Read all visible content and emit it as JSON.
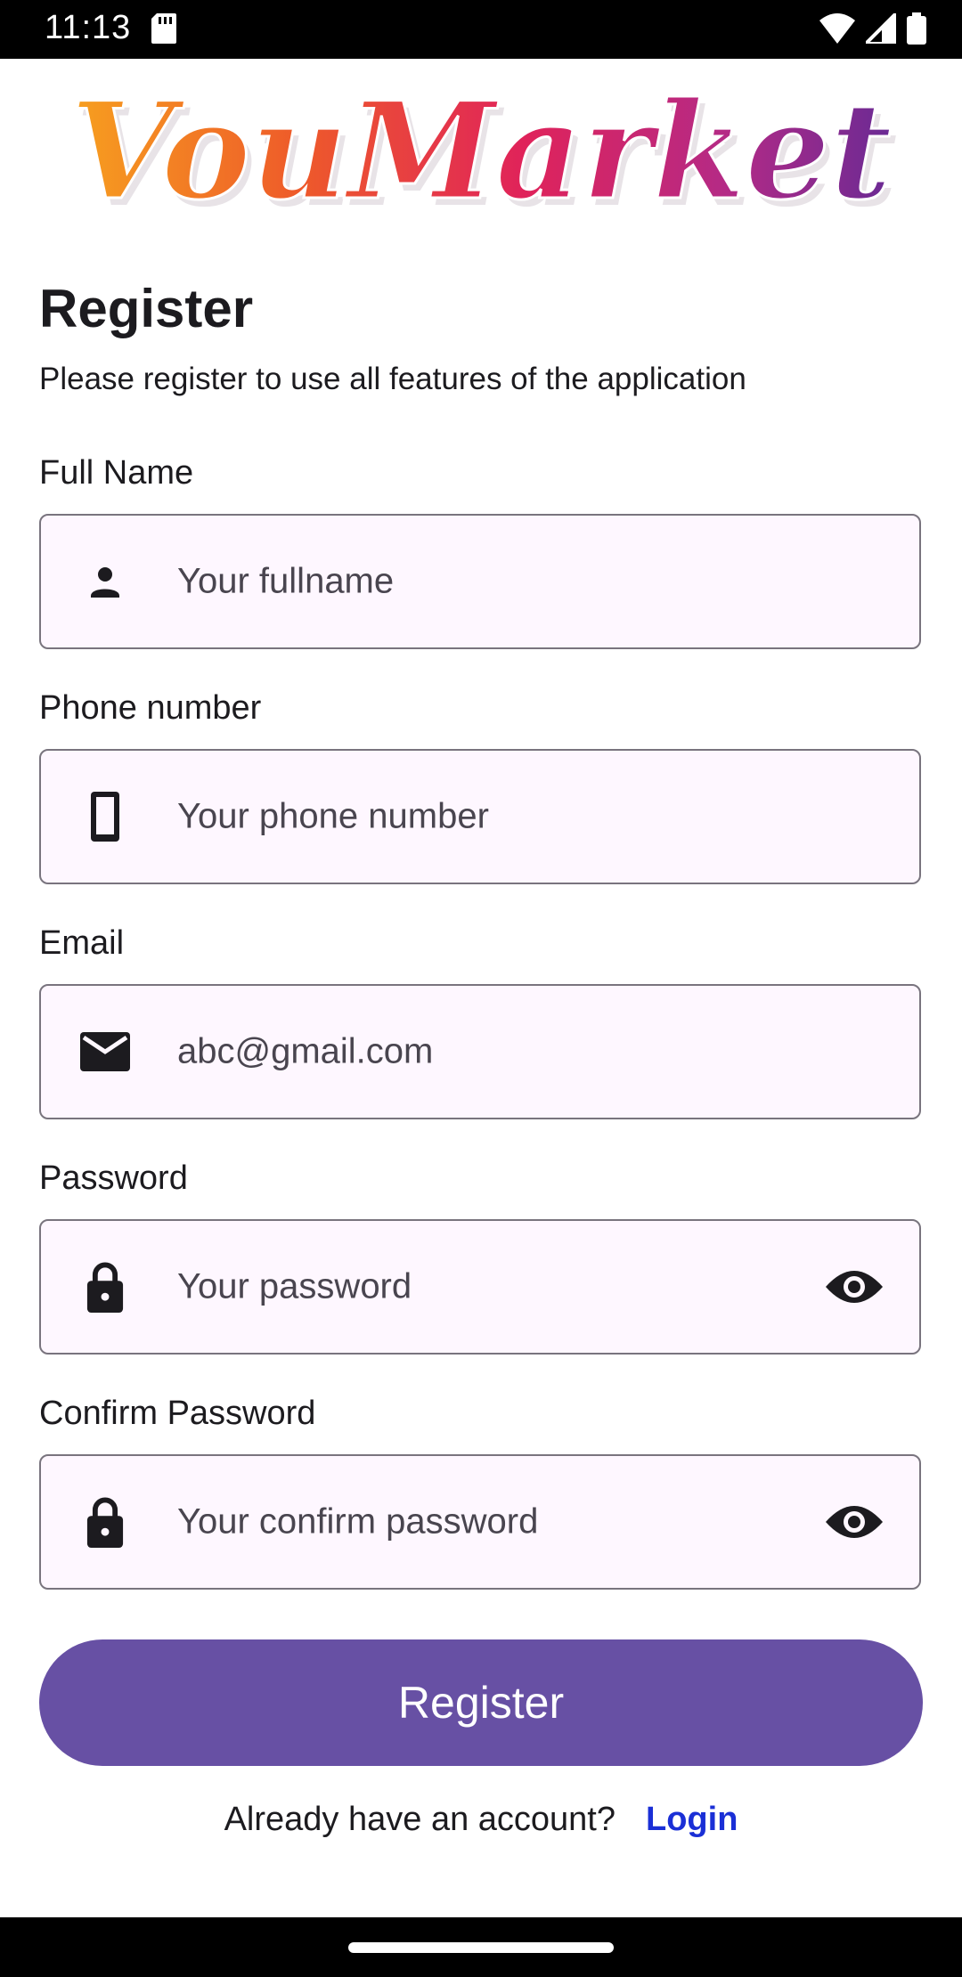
{
  "status_bar": {
    "time": "11:13",
    "icons": [
      "sd-card-icon",
      "wifi-icon",
      "signal-icon",
      "battery-icon"
    ]
  },
  "logo": {
    "text": "VouMarket"
  },
  "header": {
    "title": "Register",
    "subtitle": "Please register to use all features of the application"
  },
  "form": {
    "full_name": {
      "label": "Full Name",
      "placeholder": "Your fullname",
      "icon": "person-icon"
    },
    "phone": {
      "label": "Phone number",
      "placeholder": "Your phone number",
      "icon": "phone-icon"
    },
    "email": {
      "label": "Email",
      "value": "abc@gmail.com",
      "icon": "mail-icon"
    },
    "password": {
      "label": "Password",
      "placeholder": "Your password",
      "icon": "lock-icon",
      "toggle_icon": "eye-icon"
    },
    "confirm_password": {
      "label": "Confirm Password",
      "placeholder": "Your confirm password",
      "icon": "lock-icon",
      "toggle_icon": "eye-icon"
    }
  },
  "actions": {
    "register_label": "Register",
    "login_prompt": "Already have an account?",
    "login_label": "Login"
  },
  "colors": {
    "primary": "#6750a4",
    "field_background": "#fef7ff",
    "field_border": "#79747e",
    "link": "#1a2fd6"
  }
}
